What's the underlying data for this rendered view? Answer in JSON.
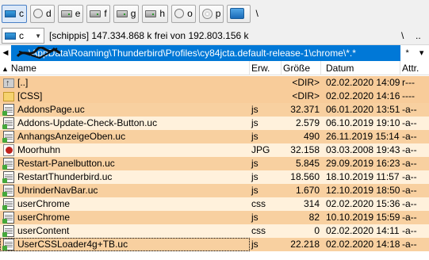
{
  "drives": [
    {
      "letter": "c",
      "icon": "windows-drive-icon",
      "active": true
    },
    {
      "letter": "d",
      "icon": "usb-drive-icon",
      "active": false
    },
    {
      "letter": "e",
      "icon": "hard-drive-icon",
      "active": false
    },
    {
      "letter": "f",
      "icon": "hard-drive-icon",
      "active": false
    },
    {
      "letter": "g",
      "icon": "hard-drive-icon",
      "active": false
    },
    {
      "letter": "h",
      "icon": "hard-drive-icon",
      "active": false
    },
    {
      "letter": "o",
      "icon": "usb-drive-icon",
      "active": false
    },
    {
      "letter": "p",
      "icon": "cd-drive-icon",
      "active": false
    },
    {
      "letter": "",
      "icon": "network-drive-icon",
      "active": false
    }
  ],
  "drive_bar_extra": "\\",
  "info": {
    "drive_value": "c",
    "free_text": "[schippis]  147.334.868 k frei von 192.803.156 k",
    "root_button": "\\",
    "up_button": ".."
  },
  "path": {
    "text": "\\AppData\\Roaming\\Thunderbird\\Profiles\\cy84jcta.default-release-1\\chrome\\*.*",
    "filter": "*",
    "filter_arrow": "▾",
    "history_arrow": "◀"
  },
  "columns": {
    "name": "Name",
    "ext": "Erw.",
    "size": "Größe",
    "date": "Datum",
    "attr": "Attr."
  },
  "files": [
    {
      "name": "[..]",
      "ext": "",
      "size": "<DIR>",
      "date": "02.02.2020 14:09",
      "attr": "r---",
      "type": "up"
    },
    {
      "name": "[CSS]",
      "ext": "",
      "size": "<DIR>",
      "date": "02.02.2020 14:16",
      "attr": "----",
      "type": "folder"
    },
    {
      "name": "AddonsPage.uc",
      "ext": "js",
      "size": "32.371",
      "date": "06.01.2020 13:51",
      "attr": "-a--",
      "type": "file"
    },
    {
      "name": "Addons-Update-Check-Button.uc",
      "ext": "js",
      "size": "2.579",
      "date": "06.10.2019 19:10",
      "attr": "-a--",
      "type": "file"
    },
    {
      "name": "AnhangsAnzeigeOben.uc",
      "ext": "js",
      "size": "490",
      "date": "26.11.2019 15:14",
      "attr": "-a--",
      "type": "file"
    },
    {
      "name": "Moorhuhn",
      "ext": "JPG",
      "size": "32.158",
      "date": "03.03.2008 19:43",
      "attr": "-a--",
      "type": "image"
    },
    {
      "name": "Restart-Panelbutton.uc",
      "ext": "js",
      "size": "5.845",
      "date": "29.09.2019 16:23",
      "attr": "-a--",
      "type": "file"
    },
    {
      "name": "RestartThunderbird.uc",
      "ext": "js",
      "size": "18.560",
      "date": "18.10.2019 11:57",
      "attr": "-a--",
      "type": "file"
    },
    {
      "name": "UhrinderNavBar.uc",
      "ext": "js",
      "size": "1.670",
      "date": "12.10.2019 18:50",
      "attr": "-a--",
      "type": "file"
    },
    {
      "name": "userChrome",
      "ext": "css",
      "size": "314",
      "date": "02.02.2020 15:36",
      "attr": "-a--",
      "type": "file"
    },
    {
      "name": "userChrome",
      "ext": "js",
      "size": "82",
      "date": "10.10.2019 15:59",
      "attr": "-a--",
      "type": "file"
    },
    {
      "name": "userContent",
      "ext": "css",
      "size": "0",
      "date": "02.02.2020 14:11",
      "attr": "-a--",
      "type": "file"
    },
    {
      "name": "UserCSSLoader4g+TB.uc",
      "ext": "js",
      "size": "22.218",
      "date": "02.02.2020 14:18",
      "attr": "-a--",
      "type": "file",
      "focused": true
    }
  ],
  "colors": {
    "row_odd": "#f8d0a0",
    "row_even": "#fff1dc",
    "path_bg": "#0078d7"
  }
}
